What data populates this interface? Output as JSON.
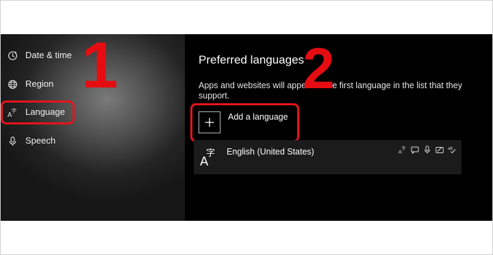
{
  "sidebar": {
    "items": [
      {
        "label": "Date & time",
        "icon": "clock-icon"
      },
      {
        "label": "Region",
        "icon": "globe-icon"
      },
      {
        "label": "Language",
        "icon": "language-icon",
        "selected": true
      },
      {
        "label": "Speech",
        "icon": "microphone-icon"
      }
    ]
  },
  "annotations": {
    "step1": "1",
    "step2": "2",
    "color": "#e50d12"
  },
  "main": {
    "title": "Preferred languages",
    "description": "Apps and websites will appear in the first language in the list that they support.",
    "add_language_label": "Add a language",
    "languages": [
      {
        "name": "English (United States)",
        "capabilities": [
          "display-language-icon",
          "text-to-speech-icon",
          "speech-recognition-icon",
          "handwriting-icon",
          "spellcheck-icon"
        ]
      }
    ]
  }
}
